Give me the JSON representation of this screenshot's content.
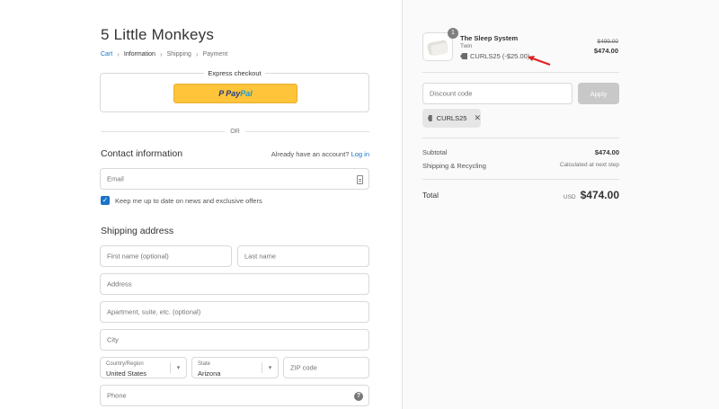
{
  "store": {
    "title": "5 Little Monkeys"
  },
  "breadcrumb": {
    "cart": "Cart",
    "information": "Information",
    "shipping": "Shipping",
    "payment": "Payment"
  },
  "express": {
    "label": "Express checkout",
    "paypal_p": "P",
    "paypal_pay": "Pay",
    "paypal_pal": "Pal"
  },
  "or_text": "OR",
  "contact": {
    "title": "Contact information",
    "account_prompt": "Already have an account?",
    "login_link": "Log in",
    "email_placeholder": "Email",
    "newsletter_label": "Keep me up to date on news and exclusive offers",
    "newsletter_checked": true
  },
  "shipping": {
    "title": "Shipping address",
    "first_name_placeholder": "First name (optional)",
    "last_name_placeholder": "Last name",
    "address_placeholder": "Address",
    "apartment_placeholder": "Apartment, suite, etc. (optional)",
    "city_placeholder": "City",
    "country_label": "Country/Region",
    "country_value": "United States",
    "state_label": "State",
    "state_value": "Arizona",
    "zip_placeholder": "ZIP code",
    "phone_placeholder": "Phone"
  },
  "order": {
    "quantity": "1",
    "product_name": "The Sleep System",
    "product_variant": "Twin",
    "discount_applied": "CURLS25 (-$25.00)",
    "price_original": "$499.00",
    "price_final": "$474.00"
  },
  "discount": {
    "placeholder": "Discount code",
    "apply_label": "Apply",
    "code_chip": "CURLS25"
  },
  "summary": {
    "subtotal_label": "Subtotal",
    "subtotal_value": "$474.00",
    "shipping_label": "Shipping & Recycling",
    "shipping_value": "Calculated at next step",
    "total_label": "Total",
    "currency": "USD",
    "total_value": "$474.00"
  },
  "colors": {
    "accent": "#1a73c7",
    "paypal_yellow": "#ffc439",
    "annotation_arrow": "#e02020"
  }
}
